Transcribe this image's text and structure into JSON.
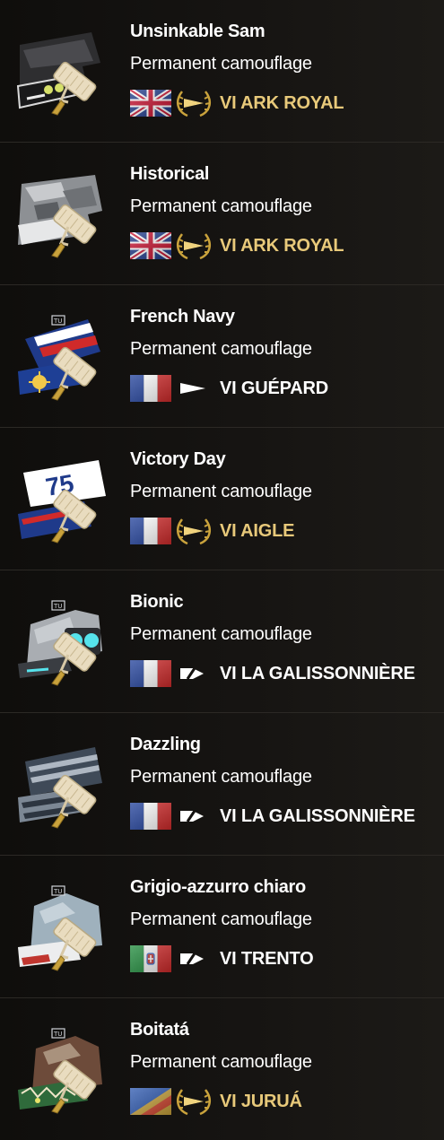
{
  "rows": [
    {
      "name": "Unsinkable Sam",
      "type": "Permanent camouflage",
      "ship": "VI ARK ROYAL",
      "nation": "uk",
      "premium": true,
      "ship_color": "#e8c97a",
      "thumb": "sam"
    },
    {
      "name": "Historical",
      "type": "Permanent camouflage",
      "ship": "VI ARK ROYAL",
      "nation": "uk",
      "premium": true,
      "ship_color": "#e8c97a",
      "thumb": "grey"
    },
    {
      "name": "French Navy",
      "type": "Permanent camouflage",
      "ship": "VI GUÉPARD",
      "nation": "france",
      "premium": false,
      "ship_color": "#ffffff",
      "thumb": "navy"
    },
    {
      "name": "Victory Day",
      "type": "Permanent camouflage",
      "ship": "VI AIGLE",
      "nation": "france",
      "premium": true,
      "ship_color": "#e8c97a",
      "thumb": "victory"
    },
    {
      "name": "Bionic",
      "type": "Permanent camouflage",
      "ship": "VI LA GALISSONNIÈRE",
      "nation": "france",
      "premium": false,
      "ship_color": "#ffffff",
      "thumb": "bionic"
    },
    {
      "name": "Dazzling",
      "type": "Permanent camouflage",
      "ship": "VI LA GALISSONNIÈRE",
      "nation": "france",
      "premium": false,
      "ship_color": "#ffffff",
      "thumb": "dazzle"
    },
    {
      "name": "Grigio-azzurro chiaro",
      "type": "Permanent camouflage",
      "ship": "VI TRENTO",
      "nation": "italy",
      "premium": false,
      "ship_color": "#ffffff",
      "thumb": "grigio"
    },
    {
      "name": "Boitatá",
      "type": "Permanent camouflage",
      "ship": "VI JURUÁ",
      "nation": "panamerica",
      "premium": true,
      "ship_color": "#e8c97a",
      "thumb": "boitata"
    }
  ],
  "icons": {
    "camo_thumbnail": "camouflage-thumbnail-icon",
    "paint_roller": "paint-roller-icon",
    "nation_flag": "nation-flag-icon",
    "ship_class": "ship-class-icon"
  }
}
